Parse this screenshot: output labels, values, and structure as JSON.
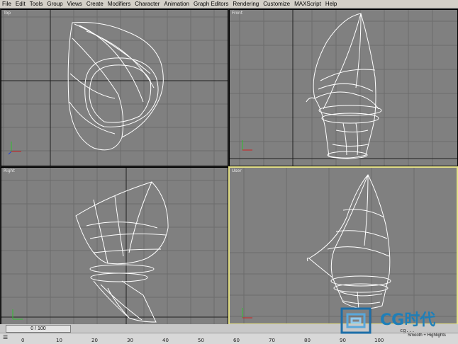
{
  "menu": [
    "File",
    "Edit",
    "Tools",
    "Group",
    "Views",
    "Create",
    "Modifiers",
    "Character",
    "Animation",
    "Graph Editors",
    "Rendering",
    "Customize",
    "MAXScript",
    "Help"
  ],
  "viewports": {
    "top": "Top",
    "front": "Front",
    "right": "Right",
    "user": "User"
  },
  "time_slider": "0 / 100",
  "timeline_ticks": [
    "0",
    "10",
    "20",
    "30",
    "40",
    "50",
    "60",
    "70",
    "80",
    "90",
    "100"
  ],
  "status_text": "Smooth + Highlights",
  "watermark": {
    "text": "CG时代",
    "sub": "cg..."
  },
  "colors": {
    "grid": "#6a6a6a",
    "wire": "#ffffff",
    "active_border": "#e6e28a",
    "viewport_bg": "#808080"
  }
}
